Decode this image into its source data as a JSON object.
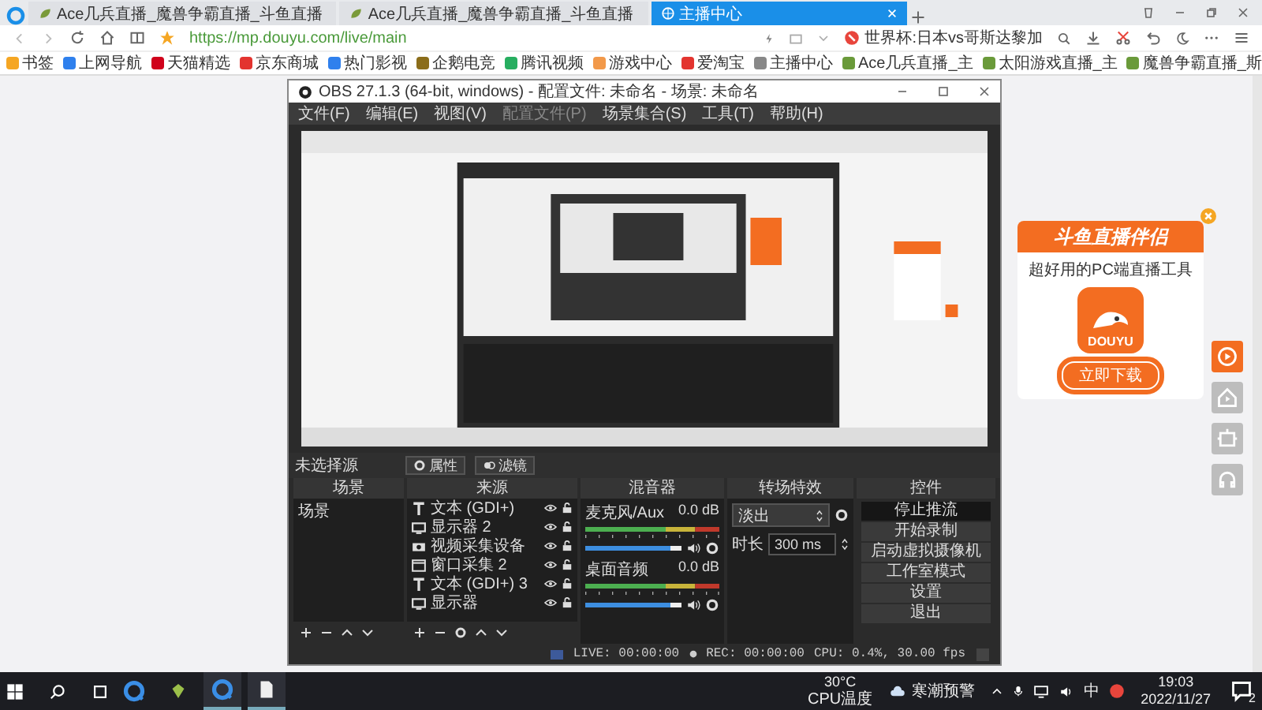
{
  "browser": {
    "tabs": [
      {
        "title": "Ace几兵直播_魔兽争霸直播_斗鱼直播",
        "selected": false
      },
      {
        "title": "Ace几兵直播_魔兽争霸直播_斗鱼直播",
        "selected": false
      },
      {
        "title": "主播中心",
        "selected": true
      }
    ],
    "url": "https://mp.douyu.com/live/main",
    "news": "世界杯:日本vs哥斯达黎加",
    "bookmarks": [
      {
        "label": "书签",
        "color": "#f5a623"
      },
      {
        "label": "上网导航",
        "color": "#2f80ed"
      },
      {
        "label": "天猫精选",
        "color": "#d0021b"
      },
      {
        "label": "京东商城",
        "color": "#e3342f"
      },
      {
        "label": "热门影视",
        "color": "#2f80ed"
      },
      {
        "label": "企鹅电竞",
        "color": "#8b6d1a"
      },
      {
        "label": "腾讯视频",
        "color": "#27ae60"
      },
      {
        "label": "游戏中心",
        "color": "#f2994a"
      },
      {
        "label": "爱淘宝",
        "color": "#e3342f"
      },
      {
        "label": "主播中心",
        "color": "#888888"
      },
      {
        "label": "Ace几兵直播_主",
        "color": "#6a9a3a"
      },
      {
        "label": "太阳游戏直播_主",
        "color": "#6a9a3a"
      },
      {
        "label": "魔兽争霸直播_斯",
        "color": "#6a9a3a"
      }
    ]
  },
  "obs": {
    "title": "OBS 27.1.3 (64-bit, windows) - 配置文件: 未命名 - 场景: 未命名",
    "menu": [
      {
        "label": "文件(F)",
        "disabled": false
      },
      {
        "label": "编辑(E)",
        "disabled": false
      },
      {
        "label": "视图(V)",
        "disabled": false
      },
      {
        "label": "配置文件(P)",
        "disabled": true
      },
      {
        "label": "场景集合(S)",
        "disabled": false
      },
      {
        "label": "工具(T)",
        "disabled": false
      },
      {
        "label": "帮助(H)",
        "disabled": false
      }
    ],
    "source_bar": {
      "label": "未选择源",
      "properties": "属性",
      "filters": "滤镜"
    },
    "docks": {
      "scenes": "场景",
      "sources": "来源",
      "mixer": "混音器",
      "transitions": "转场特效",
      "controls": "控件"
    },
    "scenes": [
      {
        "name": "场景",
        "selected": false
      }
    ],
    "sources": [
      {
        "name": "文本 (GDI+)",
        "kind": "text"
      },
      {
        "name": "显示器 2",
        "kind": "display"
      },
      {
        "name": "视频采集设备",
        "kind": "camera"
      },
      {
        "name": "窗口采集 2",
        "kind": "window"
      },
      {
        "name": "文本 (GDI+) 3",
        "kind": "text"
      },
      {
        "name": "显示器",
        "kind": "display"
      }
    ],
    "mixer": [
      {
        "name": "麦克风/Aux",
        "reading": "0.0 dB",
        "level": 1
      },
      {
        "name": "桌面音频",
        "reading": "0.0 dB",
        "level": 1
      }
    ],
    "transition": {
      "type": "淡出",
      "duration_label": "时长",
      "duration": "300 ms"
    },
    "controls": [
      {
        "label": "停止推流",
        "active": true
      },
      {
        "label": "开始录制",
        "active": false
      },
      {
        "label": "启动虚拟摄像机",
        "active": false
      },
      {
        "label": "工作室模式",
        "active": false
      },
      {
        "label": "设置",
        "active": false
      },
      {
        "label": "退出",
        "active": false
      }
    ],
    "status": {
      "live": "LIVE: 00:00:00",
      "rec": "REC: 00:00:00",
      "cpu": "CPU: 0.4%, 30.00 fps"
    }
  },
  "ad": {
    "title": "斗鱼直播伴侣",
    "subtitle": "超好用的PC端直播工具",
    "app_name": "DOUYU",
    "button": "立即下载"
  },
  "side_buttons": [
    {
      "kind": "play",
      "selected": true
    },
    {
      "kind": "home",
      "selected": false
    },
    {
      "kind": "robot",
      "selected": false
    },
    {
      "kind": "headset",
      "selected": false
    }
  ],
  "taskbar": {
    "apps": [
      {
        "kind": "browser",
        "active": false
      },
      {
        "kind": "app",
        "active": false
      },
      {
        "kind": "browser",
        "active": true
      },
      {
        "kind": "file",
        "active": true
      }
    ],
    "temperature": "30°C",
    "temperature_label": "CPU温度",
    "weather": "寒潮预警",
    "ime": "中",
    "time": "19:03",
    "date": "2022/11/27",
    "notifications": "2"
  }
}
